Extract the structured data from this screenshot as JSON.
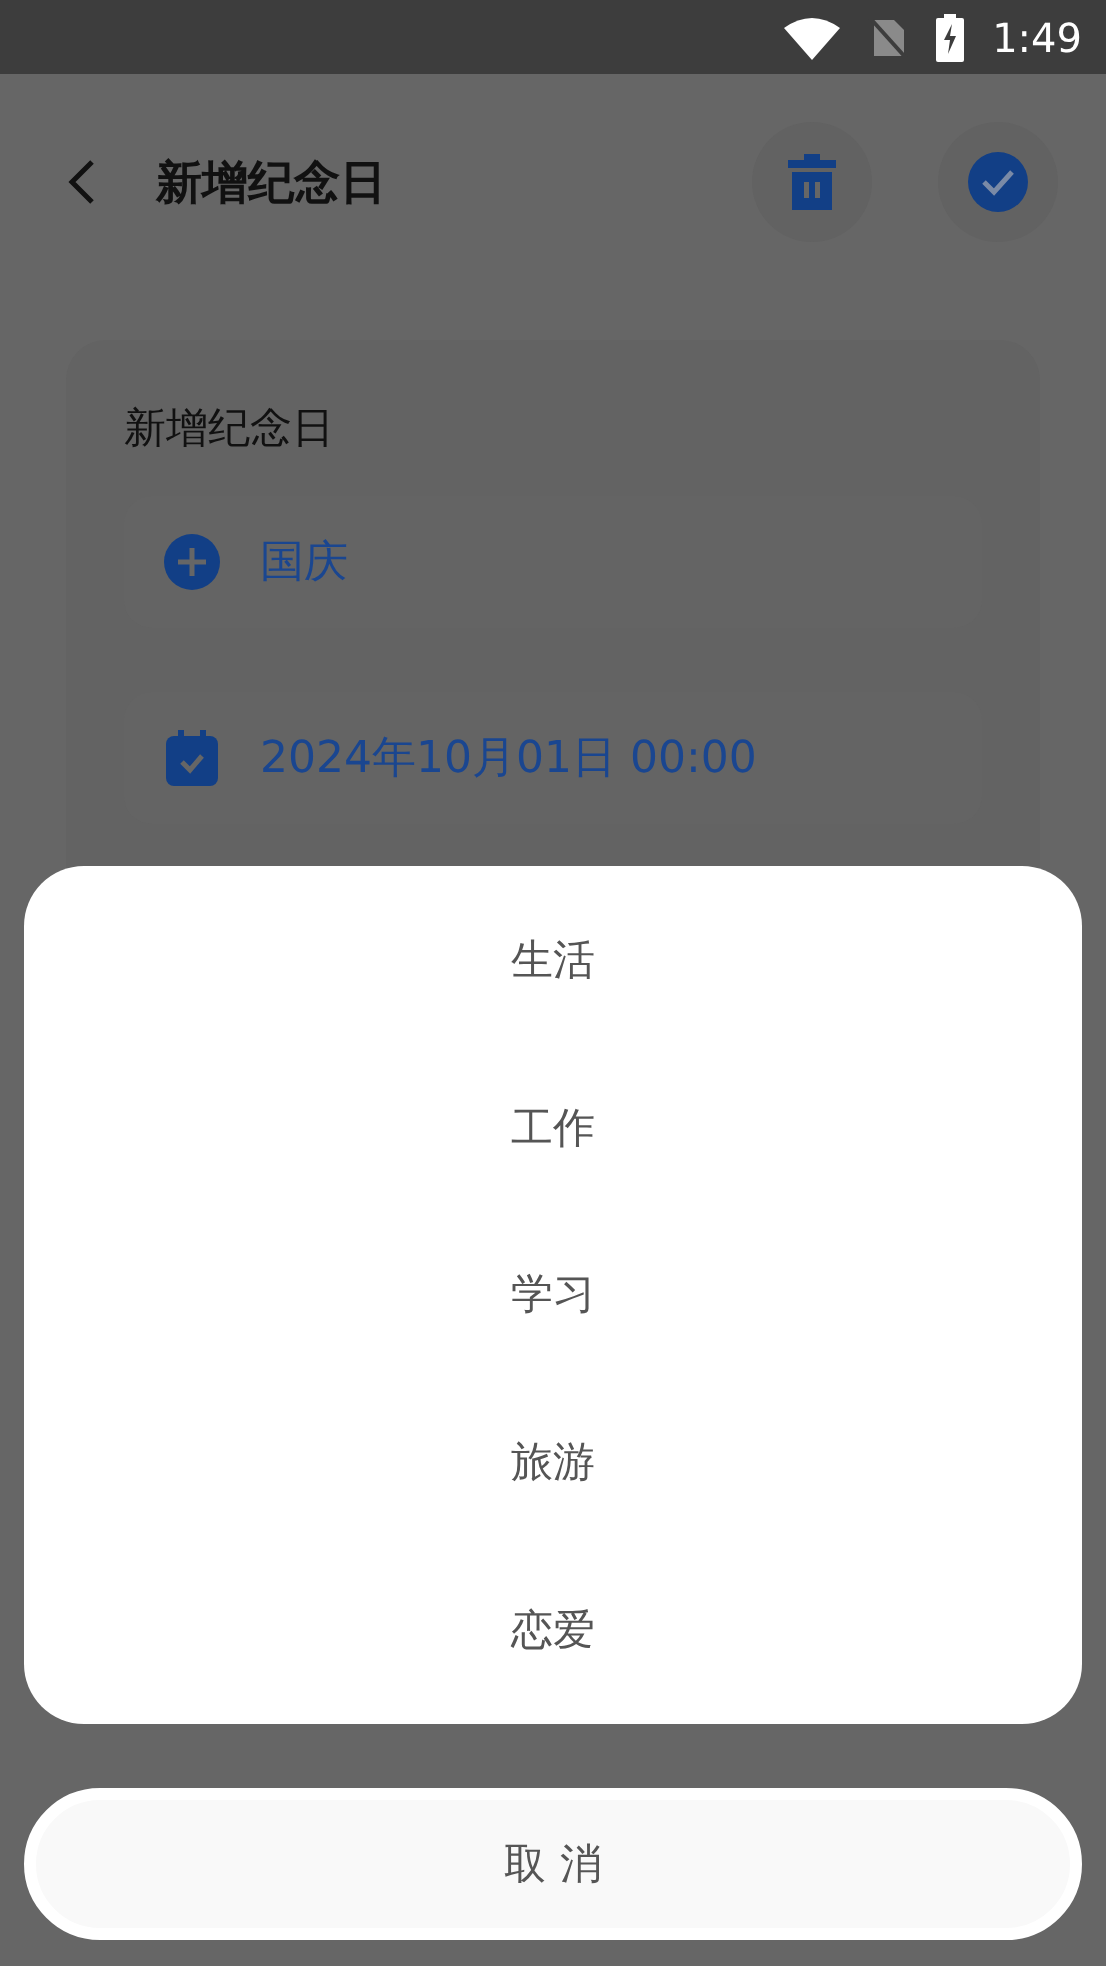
{
  "status_bar": {
    "time": "1:49"
  },
  "header": {
    "title": "新增纪念日"
  },
  "card": {
    "title": "新增纪念日",
    "name_field": {
      "value": "国庆"
    },
    "date_field": {
      "value": "2024年10月01日 00:00"
    }
  },
  "sheet": {
    "options": [
      "生活",
      "工作",
      "学习",
      "旅游",
      "恋爱"
    ],
    "cancel": "取 消"
  }
}
